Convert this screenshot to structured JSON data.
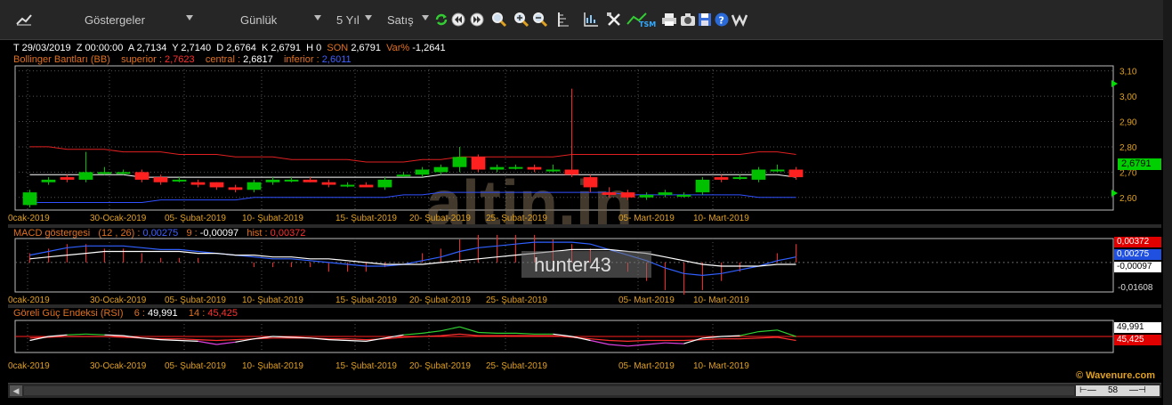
{
  "toolbar": {
    "indicators_label": "Göstergeler",
    "period_label": "Günlük",
    "range_label": "5 Yıl",
    "side_label": "Satış"
  },
  "header": {
    "date": "T 29/03/2019",
    "time": "Z 00:00:00",
    "open": "A 2,7134",
    "high": "Y 2,7140",
    "low": "D 2,6764",
    "close": "K 2,6791",
    "volume": "H 0",
    "last_label": "SON",
    "last_value": "2,6791",
    "change_label": "Var%",
    "change_value": "-1,2641"
  },
  "bollinger": {
    "label": "Bollinger Bantları (BB)",
    "superior_label": "superior :",
    "superior_value": "2,7623",
    "central_label": "central :",
    "central_value": "2,6817",
    "inferior_label": "inferior :",
    "inferior_value": "2,6011"
  },
  "macd": {
    "label": "MACD göstergesi",
    "params": "(12 , 26) :",
    "macd_value": "0,00275",
    "signal_period": "9 :",
    "signal_value": "-0,00097",
    "hist_label": "hist :",
    "hist_value": "0,00372",
    "min_value": "-0,01608"
  },
  "rsi": {
    "label": "Göreli Güç Endeksi (RSI)",
    "p1": "6 :",
    "v1": "49,991",
    "p2": "14 :",
    "v2": "45,425"
  },
  "dates": [
    "0cak-2019",
    "30-Ocak-2019",
    "05- Şubat-2019",
    "10- Şubat-2019",
    "15- Şubat-2019",
    "20- Şubat-2019",
    "25- Şubat-2019",
    "05- Mart-2019",
    "10- Mart-2019"
  ],
  "price_ticks": [
    "3,10",
    "3,00",
    "2,90",
    "2,80",
    "2,70",
    "2,60"
  ],
  "current_price": "2,6791",
  "watermark": "altin.in",
  "watermark2": "hunter43",
  "credit": "© Wavenure.com",
  "scroll_value": "58",
  "colors": {
    "up": "#00c000",
    "down": "#ff2020",
    "upper_band": "#e02020",
    "lower_band": "#3050ff",
    "center_band": "#ffffff",
    "header_orange": "#e07020",
    "axis": "#e0a020"
  },
  "chart_data": {
    "type": "candlestick",
    "ylim": [
      2.55,
      3.12
    ],
    "candles": [
      {
        "o": 2.57,
        "c": 2.62,
        "h": 2.63,
        "l": 2.56
      },
      {
        "o": 2.66,
        "c": 2.67,
        "h": 2.68,
        "l": 2.65
      },
      {
        "o": 2.68,
        "c": 2.67,
        "h": 2.69,
        "l": 2.66
      },
      {
        "o": 2.67,
        "c": 2.7,
        "h": 2.78,
        "l": 2.66
      },
      {
        "o": 2.7,
        "c": 2.7,
        "h": 2.72,
        "l": 2.69
      },
      {
        "o": 2.7,
        "c": 2.7,
        "h": 2.71,
        "l": 2.69
      },
      {
        "o": 2.7,
        "c": 2.67,
        "h": 2.71,
        "l": 2.66
      },
      {
        "o": 2.68,
        "c": 2.66,
        "h": 2.69,
        "l": 2.65
      },
      {
        "o": 2.67,
        "c": 2.67,
        "h": 2.68,
        "l": 2.66
      },
      {
        "o": 2.66,
        "c": 2.65,
        "h": 2.67,
        "l": 2.64
      },
      {
        "o": 2.66,
        "c": 2.64,
        "h": 2.66,
        "l": 2.63
      },
      {
        "o": 2.64,
        "c": 2.63,
        "h": 2.65,
        "l": 2.62
      },
      {
        "o": 2.63,
        "c": 2.66,
        "h": 2.67,
        "l": 2.62
      },
      {
        "o": 2.66,
        "c": 2.67,
        "h": 2.68,
        "l": 2.65
      },
      {
        "o": 2.67,
        "c": 2.67,
        "h": 2.68,
        "l": 2.66
      },
      {
        "o": 2.67,
        "c": 2.66,
        "h": 2.68,
        "l": 2.66
      },
      {
        "o": 2.66,
        "c": 2.65,
        "h": 2.67,
        "l": 2.64
      },
      {
        "o": 2.65,
        "c": 2.65,
        "h": 2.66,
        "l": 2.64
      },
      {
        "o": 2.65,
        "c": 2.64,
        "h": 2.66,
        "l": 2.64
      },
      {
        "o": 2.64,
        "c": 2.67,
        "h": 2.68,
        "l": 2.63
      },
      {
        "o": 2.69,
        "c": 2.69,
        "h": 2.7,
        "l": 2.68
      },
      {
        "o": 2.69,
        "c": 2.71,
        "h": 2.72,
        "l": 2.68
      },
      {
        "o": 2.7,
        "c": 2.72,
        "h": 2.73,
        "l": 2.69
      },
      {
        "o": 2.72,
        "c": 2.76,
        "h": 2.8,
        "l": 2.7
      },
      {
        "o": 2.76,
        "c": 2.71,
        "h": 2.77,
        "l": 2.7
      },
      {
        "o": 2.71,
        "c": 2.72,
        "h": 2.73,
        "l": 2.7
      },
      {
        "o": 2.72,
        "c": 2.72,
        "h": 2.73,
        "l": 2.71
      },
      {
        "o": 2.72,
        "c": 2.71,
        "h": 2.73,
        "l": 2.7
      },
      {
        "o": 2.71,
        "c": 2.71,
        "h": 2.73,
        "l": 2.7
      },
      {
        "o": 2.71,
        "c": 2.69,
        "h": 3.03,
        "l": 2.68
      },
      {
        "o": 2.68,
        "c": 2.64,
        "h": 2.69,
        "l": 2.62
      },
      {
        "o": 2.62,
        "c": 2.61,
        "h": 2.64,
        "l": 2.6
      },
      {
        "o": 2.62,
        "c": 2.6,
        "h": 2.63,
        "l": 2.59
      },
      {
        "o": 2.6,
        "c": 2.61,
        "h": 2.62,
        "l": 2.59
      },
      {
        "o": 2.61,
        "c": 2.62,
        "h": 2.63,
        "l": 2.6
      },
      {
        "o": 2.61,
        "c": 2.61,
        "h": 2.62,
        "l": 2.6
      },
      {
        "o": 2.62,
        "c": 2.67,
        "h": 2.68,
        "l": 2.61
      },
      {
        "o": 2.68,
        "c": 2.67,
        "h": 2.69,
        "l": 2.66
      },
      {
        "o": 2.68,
        "c": 2.68,
        "h": 2.69,
        "l": 2.67
      },
      {
        "o": 2.67,
        "c": 2.71,
        "h": 2.72,
        "l": 2.66
      },
      {
        "o": 2.71,
        "c": 2.71,
        "h": 2.73,
        "l": 2.7
      },
      {
        "o": 2.71,
        "c": 2.68,
        "h": 2.72,
        "l": 2.67
      }
    ],
    "upper_band": [
      2.8,
      2.8,
      2.79,
      2.79,
      2.79,
      2.78,
      2.78,
      2.78,
      2.77,
      2.77,
      2.77,
      2.76,
      2.76,
      2.76,
      2.75,
      2.75,
      2.75,
      2.75,
      2.74,
      2.74,
      2.74,
      2.75,
      2.75,
      2.76,
      2.76,
      2.76,
      2.76,
      2.76,
      2.76,
      2.77,
      2.77,
      2.77,
      2.77,
      2.77,
      2.77,
      2.77,
      2.77,
      2.77,
      2.77,
      2.78,
      2.78,
      2.77
    ],
    "center_band": [
      2.69,
      2.69,
      2.69,
      2.69,
      2.69,
      2.69,
      2.68,
      2.68,
      2.68,
      2.68,
      2.68,
      2.68,
      2.68,
      2.68,
      2.68,
      2.68,
      2.68,
      2.68,
      2.68,
      2.68,
      2.68,
      2.68,
      2.69,
      2.69,
      2.69,
      2.69,
      2.69,
      2.69,
      2.69,
      2.69,
      2.69,
      2.69,
      2.69,
      2.69,
      2.69,
      2.69,
      2.69,
      2.69,
      2.69,
      2.69,
      2.69,
      2.68
    ],
    "lower_band": [
      2.58,
      2.58,
      2.58,
      2.58,
      2.58,
      2.58,
      2.58,
      2.59,
      2.59,
      2.59,
      2.59,
      2.59,
      2.6,
      2.6,
      2.6,
      2.6,
      2.6,
      2.6,
      2.6,
      2.6,
      2.61,
      2.61,
      2.62,
      2.62,
      2.62,
      2.62,
      2.62,
      2.62,
      2.62,
      2.62,
      2.62,
      2.62,
      2.61,
      2.61,
      2.61,
      2.61,
      2.61,
      2.61,
      2.61,
      2.6,
      2.6,
      2.6
    ],
    "macd_line": [
      0.004,
      0.006,
      0.008,
      0.009,
      0.009,
      0.009,
      0.008,
      0.007,
      0.007,
      0.006,
      0.005,
      0.004,
      0.003,
      0.002,
      0.002,
      0.001,
      0.0,
      -0.001,
      -0.002,
      -0.002,
      -0.001,
      0.001,
      0.003,
      0.006,
      0.008,
      0.009,
      0.01,
      0.011,
      0.011,
      0.011,
      0.01,
      0.007,
      0.004,
      0.001,
      -0.003,
      -0.006,
      -0.007,
      -0.006,
      -0.004,
      -0.002,
      0.001,
      0.003
    ],
    "signal_line": [
      0.002,
      0.003,
      0.004,
      0.005,
      0.006,
      0.006,
      0.006,
      0.006,
      0.006,
      0.005,
      0.005,
      0.004,
      0.004,
      0.003,
      0.003,
      0.002,
      0.002,
      0.001,
      0.0,
      -0.001,
      -0.001,
      -0.001,
      0.0,
      0.001,
      0.002,
      0.003,
      0.004,
      0.005,
      0.006,
      0.007,
      0.007,
      0.007,
      0.006,
      0.005,
      0.003,
      0.001,
      -0.001,
      -0.002,
      -0.002,
      -0.002,
      -0.001,
      -0.001
    ],
    "rsi6": [
      45,
      50,
      52,
      53,
      52,
      51,
      48,
      46,
      45,
      44,
      40,
      43,
      47,
      50,
      49,
      48,
      46,
      45,
      44,
      48,
      52,
      54,
      57,
      62,
      55,
      54,
      54,
      53,
      53,
      50,
      45,
      40,
      38,
      40,
      42,
      41,
      48,
      50,
      51,
      56,
      58,
      50
    ],
    "rsi14": [
      48,
      49,
      50,
      50,
      50,
      49,
      48,
      47,
      47,
      46,
      45,
      46,
      47,
      48,
      48,
      48,
      47,
      47,
      46,
      47,
      49,
      50,
      51,
      53,
      51,
      51,
      51,
      51,
      51,
      49,
      47,
      45,
      44,
      45,
      45,
      45,
      46,
      47,
      47,
      48,
      49,
      45
    ]
  }
}
